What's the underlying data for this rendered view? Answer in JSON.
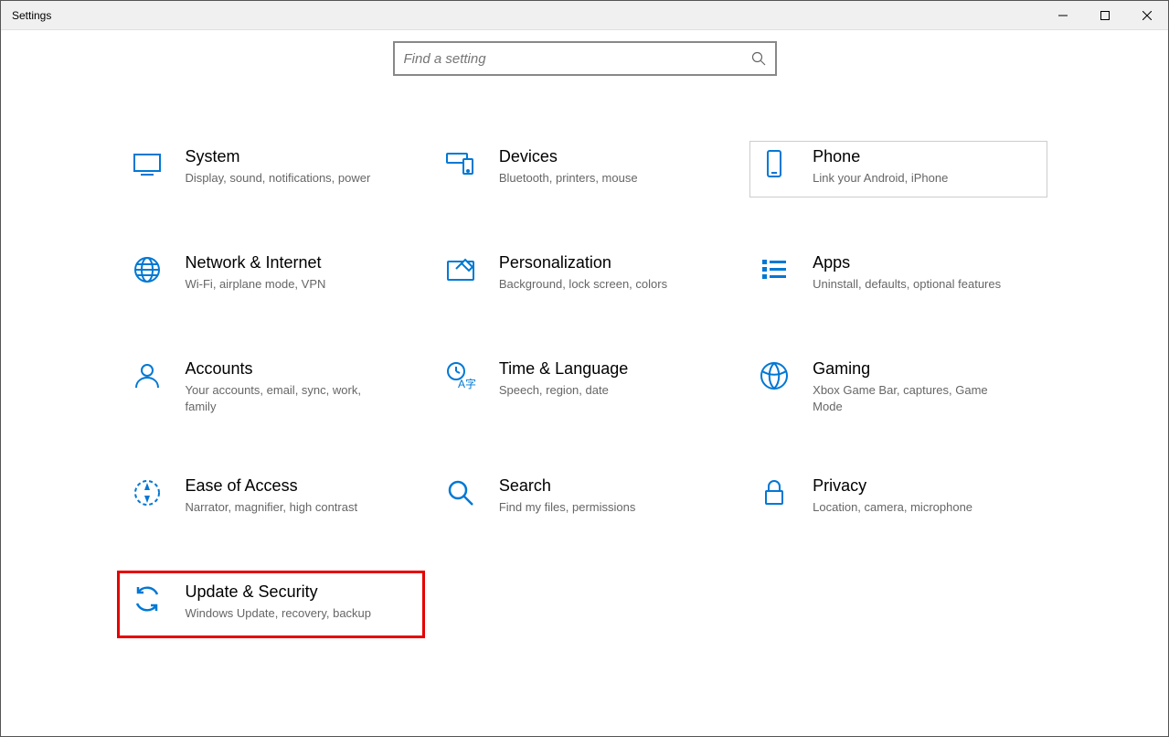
{
  "window": {
    "title": "Settings"
  },
  "search": {
    "placeholder": "Find a setting"
  },
  "tiles": {
    "system": {
      "title": "System",
      "desc": "Display, sound, notifications, power"
    },
    "devices": {
      "title": "Devices",
      "desc": "Bluetooth, printers, mouse"
    },
    "phone": {
      "title": "Phone",
      "desc": "Link your Android, iPhone"
    },
    "network": {
      "title": "Network & Internet",
      "desc": "Wi-Fi, airplane mode, VPN"
    },
    "personalization": {
      "title": "Personalization",
      "desc": "Background, lock screen, colors"
    },
    "apps": {
      "title": "Apps",
      "desc": "Uninstall, defaults, optional features"
    },
    "accounts": {
      "title": "Accounts",
      "desc": "Your accounts, email, sync, work, family"
    },
    "time": {
      "title": "Time & Language",
      "desc": "Speech, region, date"
    },
    "gaming": {
      "title": "Gaming",
      "desc": "Xbox Game Bar, captures, Game Mode"
    },
    "ease": {
      "title": "Ease of Access",
      "desc": "Narrator, magnifier, high contrast"
    },
    "search_tile": {
      "title": "Search",
      "desc": "Find my files, permissions"
    },
    "privacy": {
      "title": "Privacy",
      "desc": "Location, camera, microphone"
    },
    "update": {
      "title": "Update & Security",
      "desc": "Windows Update, recovery, backup"
    }
  },
  "colors": {
    "accent": "#0078d4"
  }
}
